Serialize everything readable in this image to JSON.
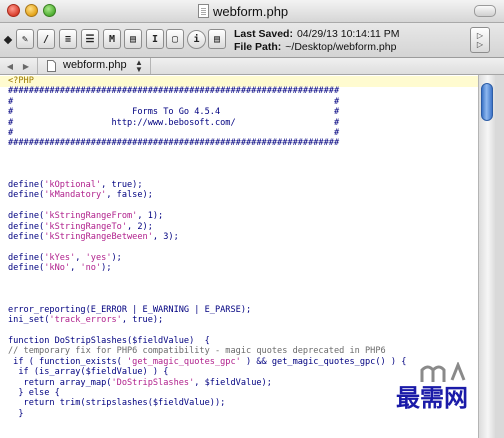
{
  "window": {
    "title": "webform.php"
  },
  "toolbar": {
    "buttons": [
      {
        "name": "pen-tool-button",
        "glyph": "✎"
      },
      {
        "name": "pencil-tool-button",
        "glyph": "/"
      },
      {
        "name": "list-button",
        "glyph": "≡"
      },
      {
        "name": "format-button",
        "glyph": "☰"
      },
      {
        "name": "markup-button",
        "glyph": "M"
      },
      {
        "name": "document-button",
        "glyph": "▤"
      },
      {
        "name": "cursor-button",
        "glyph": "I"
      },
      {
        "name": "window-button",
        "glyph": "▢"
      },
      {
        "name": "info-button",
        "glyph": "i"
      },
      {
        "name": "page-button",
        "glyph": "▤"
      }
    ],
    "saved_label": "Last Saved:",
    "saved_value": "04/29/13 10:14:11 PM",
    "path_label": "File Path:",
    "path_value": "~/Desktop/webform.php"
  },
  "tab": {
    "label": "webform.php"
  },
  "code": [
    "<?PHP",
    "################################################################",
    "#                                                              #",
    "#                       Forms To Go 4.5.4                      #",
    "#                   http://www.bebosoft.com/                   #",
    "#                                                              #",
    "################################################################",
    "",
    "",
    "",
    "define('kOptional', true);",
    "define('kMandatory', false);",
    "",
    "define('kStringRangeFrom', 1);",
    "define('kStringRangeTo', 2);",
    "define('kStringRangeBetween', 3);",
    "",
    "define('kYes', 'yes');",
    "define('kNo', 'no');",
    "",
    "",
    "",
    "error_reporting(E_ERROR | E_WARNING | E_PARSE);",
    "ini_set('track_errors', true);",
    "",
    "function DoStripSlashes($fieldValue)  {",
    "// temporary fix for PHP6 compatibility - magic quotes deprecated in PHP6",
    " if ( function_exists( 'get_magic_quotes_gpc' ) && get_magic_quotes_gpc() ) {",
    "  if (is_array($fieldValue) ) {",
    "   return array_map('DoStripSlashes', $fieldValue);",
    "  } else {",
    "   return trim(stripslashes($fieldValue));",
    "  }"
  ],
  "watermark": {
    "text": "最需网"
  },
  "colors": {
    "code": "#000080",
    "string": "#b0208c",
    "tag": "#9c7a00",
    "scroll_thumb": "#3b73c7"
  }
}
